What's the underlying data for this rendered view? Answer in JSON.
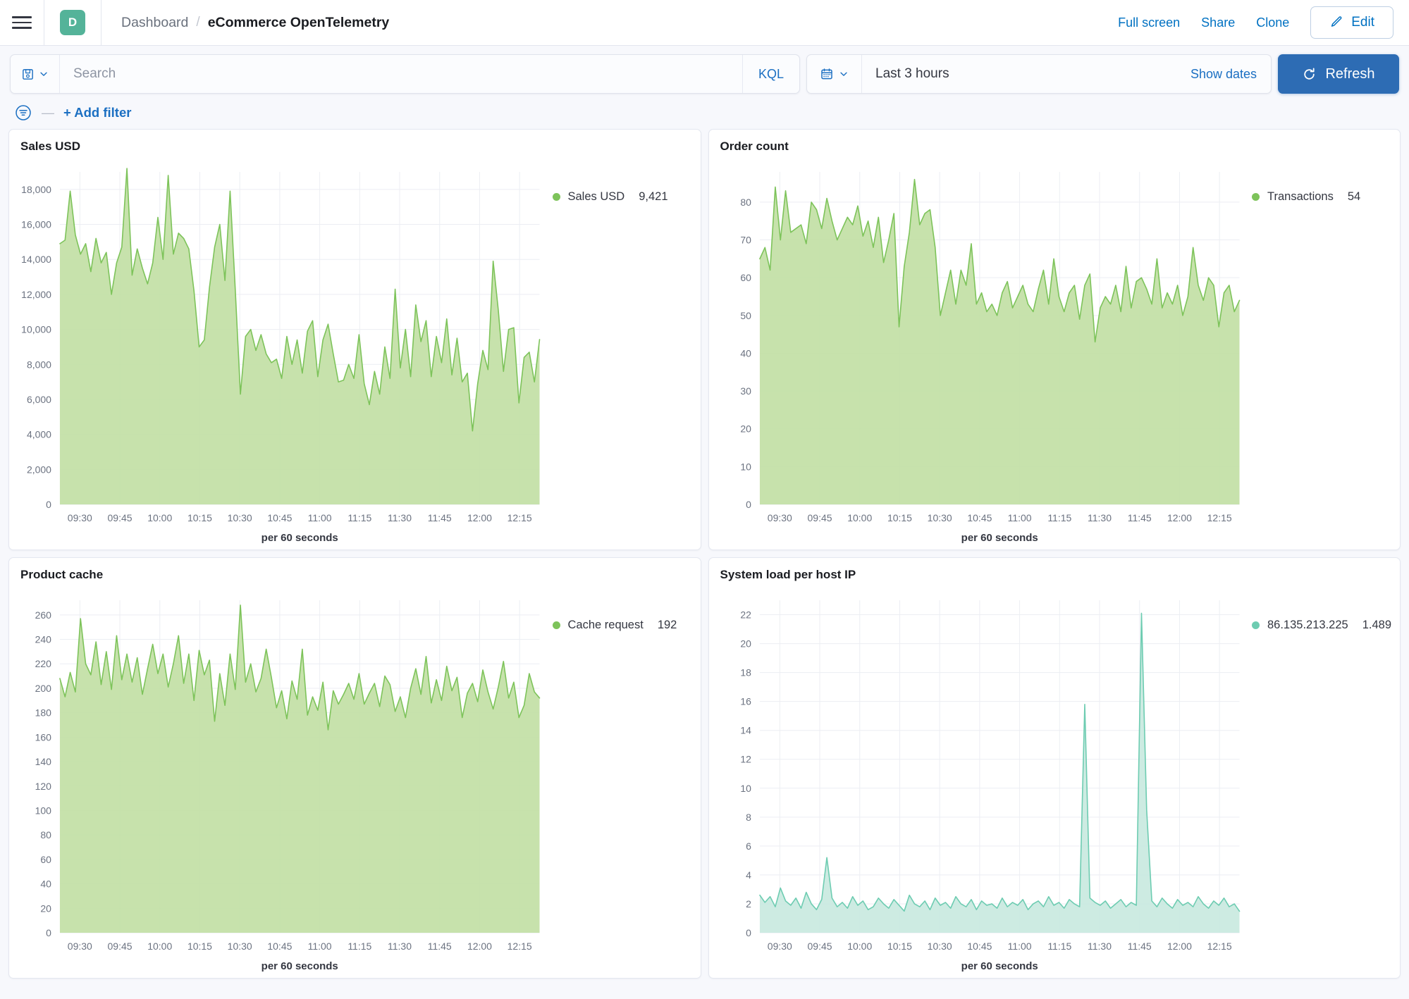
{
  "header": {
    "menu_icon": "hamburger-menu-icon",
    "app_badge": "D",
    "breadcrumb_root": "Dashboard",
    "breadcrumb_sep": "/",
    "breadcrumb_current": "eCommerce OpenTelemetry",
    "full_screen": "Full screen",
    "share": "Share",
    "clone": "Clone",
    "edit": "Edit",
    "edit_icon": "pencil-icon"
  },
  "query_bar": {
    "saved_query_icon": "save-disk-icon",
    "saved_query_chevron": "chevron-down-icon",
    "search_placeholder": "Search",
    "search_value": "",
    "language": "KQL",
    "calendar_icon": "calendar-icon",
    "calendar_chevron": "chevron-down-icon",
    "time_range": "Last 3 hours",
    "show_dates": "Show dates",
    "refresh": "Refresh",
    "refresh_icon": "refresh-icon"
  },
  "filter_bar": {
    "filter_icon": "filter-funnel-icon",
    "dash": "—",
    "add_filter": "+ Add filter"
  },
  "colors": {
    "accent_blue": "#0071c2",
    "primary_button": "#2d6cb4",
    "brand_teal": "#54b399",
    "series_green": "#7dc35a",
    "series_green_fill": "#c2dfa5",
    "series_teal": "#6dccb1",
    "series_teal_fill": "#c9e9df"
  },
  "chart_data": [
    {
      "panel_title": "Sales USD",
      "type": "area",
      "series_name": "Sales USD",
      "legend_value": "9,421",
      "color": "#7dc35a",
      "fill": "#c2dfa5",
      "xlabel": "per 60 seconds",
      "ylabel": "",
      "ylim": [
        0,
        19000
      ],
      "yticks": [
        0,
        2000,
        4000,
        6000,
        8000,
        10000,
        12000,
        14000,
        16000,
        18000
      ],
      "ytick_labels": [
        "0",
        "2,000",
        "4,000",
        "6,000",
        "8,000",
        "10,000",
        "12,000",
        "14,000",
        "16,000",
        "18,000"
      ],
      "xticks": [
        "09:30",
        "09:45",
        "10:00",
        "10:15",
        "10:30",
        "10:45",
        "11:00",
        "11:15",
        "11:30",
        "11:45",
        "12:00",
        "12:15"
      ],
      "grid": true,
      "values": [
        14900,
        15100,
        17900,
        15400,
        14300,
        14900,
        13300,
        15200,
        13800,
        14400,
        12000,
        13800,
        14700,
        19200,
        13100,
        14600,
        13500,
        12600,
        13800,
        16400,
        14000,
        18800,
        14300,
        15500,
        15200,
        14600,
        12200,
        9000,
        9400,
        12400,
        14700,
        16000,
        12800,
        17900,
        12300,
        6300,
        9600,
        10000,
        8800,
        9700,
        8600,
        8100,
        8300,
        7200,
        9600,
        8000,
        9400,
        7500,
        9900,
        10500,
        7300,
        9400,
        10300,
        8600,
        7000,
        7100,
        8000,
        7200,
        9700,
        6900,
        5700,
        7600,
        6300,
        9000,
        7200,
        12300,
        7800,
        10000,
        7300,
        11400,
        9300,
        10500,
        7300,
        9600,
        8100,
        10600,
        7400,
        9500,
        7000,
        7500,
        4200,
        6900,
        8800,
        7700,
        13900,
        11100,
        7600,
        10000,
        10100,
        5800,
        8400,
        8700,
        7000,
        9421
      ]
    },
    {
      "panel_title": "Order count",
      "type": "area",
      "series_name": "Transactions",
      "legend_value": "54",
      "color": "#7dc35a",
      "fill": "#c2dfa5",
      "xlabel": "per 60 seconds",
      "ylabel": "",
      "ylim": [
        0,
        88
      ],
      "yticks": [
        0,
        10,
        20,
        30,
        40,
        50,
        60,
        70,
        80
      ],
      "ytick_labels": [
        "0",
        "10",
        "20",
        "30",
        "40",
        "50",
        "60",
        "70",
        "80"
      ],
      "xticks": [
        "09:30",
        "09:45",
        "10:00",
        "10:15",
        "10:30",
        "10:45",
        "11:00",
        "11:15",
        "11:30",
        "11:45",
        "12:00",
        "12:15"
      ],
      "grid": true,
      "values": [
        65,
        68,
        62,
        84,
        70,
        83,
        72,
        73,
        74,
        69,
        80,
        78,
        73,
        81,
        75,
        70,
        73,
        76,
        74,
        79,
        71,
        75,
        68,
        76,
        64,
        70,
        77,
        47,
        63,
        72,
        86,
        74,
        77,
        78,
        68,
        50,
        56,
        62,
        53,
        62,
        58,
        69,
        53,
        56,
        51,
        53,
        50,
        56,
        59,
        52,
        55,
        58,
        53,
        51,
        57,
        62,
        53,
        65,
        55,
        51,
        56,
        58,
        49,
        58,
        61,
        43,
        52,
        55,
        53,
        58,
        51,
        63,
        52,
        59,
        60,
        57,
        53,
        65,
        52,
        56,
        53,
        58,
        50,
        55,
        68,
        58,
        54,
        60,
        58,
        47,
        56,
        58,
        51,
        54
      ]
    },
    {
      "panel_title": "Product cache",
      "type": "area",
      "series_name": "Cache request",
      "legend_value": "192",
      "color": "#7dc35a",
      "fill": "#c2dfa5",
      "xlabel": "per 60 seconds",
      "ylabel": "",
      "ylim": [
        0,
        272
      ],
      "yticks": [
        0,
        20,
        40,
        60,
        80,
        100,
        120,
        140,
        160,
        180,
        200,
        220,
        240,
        260
      ],
      "ytick_labels": [
        "0",
        "20",
        "40",
        "60",
        "80",
        "100",
        "120",
        "140",
        "160",
        "180",
        "200",
        "220",
        "240",
        "260"
      ],
      "xticks": [
        "09:30",
        "09:45",
        "10:00",
        "10:15",
        "10:30",
        "10:45",
        "11:00",
        "11:15",
        "11:30",
        "11:45",
        "12:00",
        "12:15"
      ],
      "grid": true,
      "values": [
        208,
        193,
        213,
        197,
        257,
        220,
        211,
        238,
        203,
        230,
        199,
        243,
        207,
        228,
        205,
        225,
        195,
        216,
        236,
        212,
        228,
        201,
        220,
        243,
        204,
        228,
        190,
        231,
        211,
        223,
        173,
        212,
        186,
        228,
        199,
        268,
        205,
        220,
        197,
        208,
        232,
        209,
        184,
        198,
        175,
        206,
        191,
        232,
        178,
        193,
        182,
        205,
        166,
        198,
        187,
        195,
        204,
        191,
        212,
        187,
        196,
        204,
        185,
        210,
        203,
        181,
        193,
        176,
        200,
        216,
        195,
        226,
        188,
        207,
        190,
        218,
        198,
        209,
        176,
        196,
        204,
        189,
        215,
        197,
        183,
        201,
        222,
        192,
        205,
        176,
        186,
        212,
        197,
        192
      ]
    },
    {
      "panel_title": "System load per host IP",
      "type": "area",
      "series_name": "86.135.213.225",
      "legend_value": "1.489",
      "color": "#6dccb1",
      "fill": "#c9e9df",
      "xlabel": "per 60 seconds",
      "ylabel": "",
      "ylim": [
        0,
        23
      ],
      "yticks": [
        0,
        2,
        4,
        6,
        8,
        10,
        12,
        14,
        16,
        18,
        20,
        22
      ],
      "ytick_labels": [
        "0",
        "2",
        "4",
        "6",
        "8",
        "10",
        "12",
        "14",
        "16",
        "18",
        "20",
        "22"
      ],
      "xticks": [
        "09:30",
        "09:45",
        "10:00",
        "10:15",
        "10:30",
        "10:45",
        "11:00",
        "11:15",
        "11:30",
        "11:45",
        "12:00",
        "12:15"
      ],
      "grid": true,
      "values": [
        2.6,
        2.1,
        2.5,
        1.8,
        3.1,
        2.2,
        1.9,
        2.4,
        1.7,
        2.8,
        2.0,
        1.6,
        2.3,
        5.2,
        2.4,
        1.8,
        2.1,
        1.7,
        2.5,
        1.9,
        2.2,
        1.6,
        1.8,
        2.4,
        2.0,
        1.7,
        2.3,
        1.9,
        1.5,
        2.6,
        2.0,
        1.8,
        2.2,
        1.6,
        2.4,
        1.9,
        2.1,
        1.7,
        2.5,
        2.0,
        1.8,
        2.3,
        1.6,
        2.2,
        1.9,
        2.0,
        1.7,
        2.4,
        1.8,
        2.1,
        1.9,
        2.3,
        1.6,
        2.0,
        2.2,
        1.8,
        2.5,
        1.9,
        2.1,
        1.7,
        2.3,
        2.0,
        1.8,
        15.8,
        2.4,
        2.1,
        1.9,
        2.2,
        1.7,
        2.0,
        2.3,
        1.8,
        2.1,
        1.9,
        22.1,
        8.5,
        2.2,
        1.8,
        2.4,
        2.0,
        1.7,
        2.3,
        1.9,
        2.1,
        1.8,
        2.5,
        2.0,
        1.7,
        2.2,
        1.9,
        2.4,
        1.8,
        2.0,
        1.489
      ]
    }
  ]
}
